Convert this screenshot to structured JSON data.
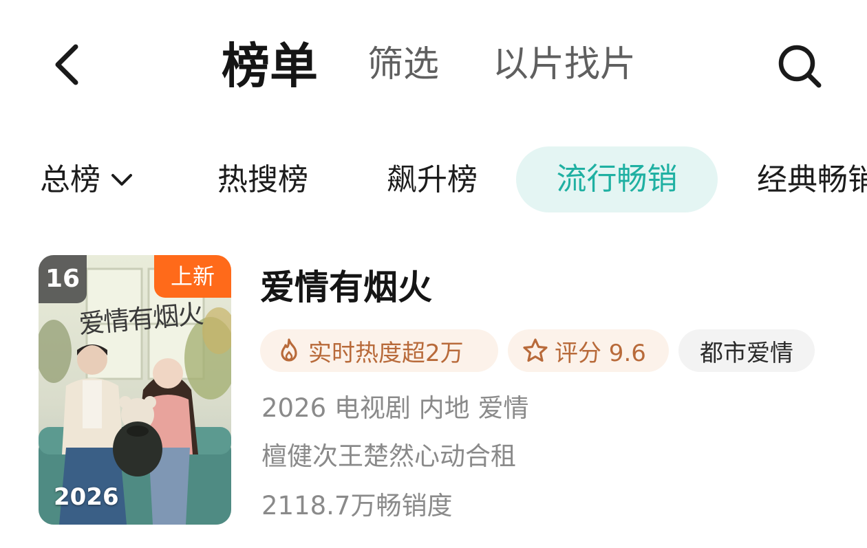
{
  "header": {
    "back_icon": "chevron-left-icon",
    "tabs": [
      {
        "label": "榜单",
        "active": true
      },
      {
        "label": "筛选",
        "active": false
      },
      {
        "label": "以片找片",
        "active": false
      }
    ],
    "search_icon": "search-icon"
  },
  "categories": {
    "items": [
      {
        "label": "总榜",
        "has_dropdown": true,
        "active": false
      },
      {
        "label": "热搜榜",
        "active": false
      },
      {
        "label": "飙升榜",
        "active": false
      },
      {
        "label": "流行畅销",
        "active": true
      },
      {
        "label": "经典畅销",
        "active": false
      }
    ],
    "active_color": "#1fb0a2",
    "active_bg": "#e4f5f3"
  },
  "item": {
    "rank": "16",
    "badge": "上新",
    "poster_title": "爱情有烟火",
    "poster_year": "2026",
    "title": "爱情有烟火",
    "tags": {
      "heat": "实时热度超2万",
      "score": "评分 9.6",
      "genre": "都市爱情"
    },
    "meta_line": "2026 电视剧 内地 爱情",
    "description": "檀健次王楚然心动合租",
    "sales": "2118.7万畅销度"
  },
  "colors": {
    "badge_orange": "#ff6a1a",
    "tag_text": "#b86a3a",
    "tag_bg": "#fcf2ea"
  }
}
